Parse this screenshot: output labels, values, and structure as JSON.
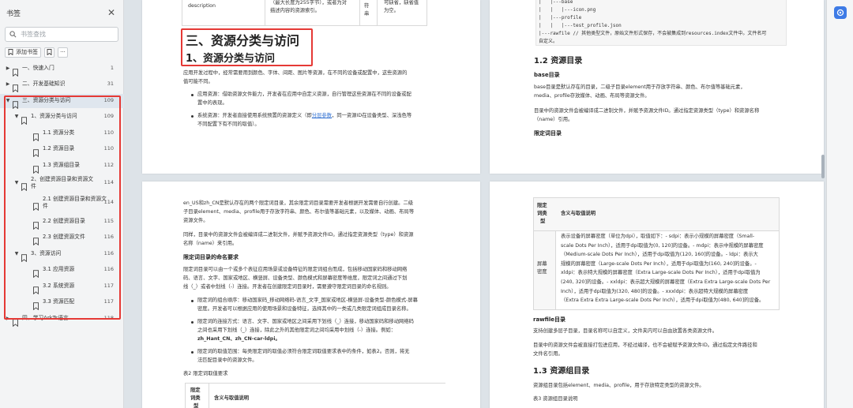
{
  "sidebar": {
    "title": "书签",
    "search_placeholder": "书签查找",
    "add_bookmark": "添加书签",
    "more": "···",
    "items": [
      {
        "label": "一、快速入门",
        "page": "1",
        "caret": "right",
        "level": 0
      },
      {
        "label": "二、开发基础知识",
        "page": "31",
        "caret": "right",
        "level": 0
      },
      {
        "label": "三、资源分类与访问",
        "page": "109",
        "caret": "down",
        "level": 0,
        "active": true
      },
      {
        "label": "1、资源分类与访问",
        "page": "109",
        "caret": "down",
        "level": 1
      },
      {
        "label": "1.1 资源分类",
        "page": "110",
        "caret": "",
        "level": 2
      },
      {
        "label": "1.2 资源目录",
        "page": "110",
        "caret": "",
        "level": 2
      },
      {
        "label": "1.3 资源组目录",
        "page": "112",
        "caret": "",
        "level": 2
      },
      {
        "label": "2、创建资源目录和资源文",
        "label2": "件",
        "page": "114",
        "caret": "down",
        "level": 1
      },
      {
        "label": "2.1 创建资源目录和资源文",
        "label2": "件",
        "page": "114",
        "caret": "",
        "level": 2
      },
      {
        "label": "2.2 创建资源目录",
        "page": "115",
        "caret": "",
        "level": 2
      },
      {
        "label": "2.3 创建资源文件",
        "page": "116",
        "caret": "",
        "level": 2
      },
      {
        "label": "3、资源访问",
        "page": "116",
        "caret": "down",
        "level": 1
      },
      {
        "label": "3.1 应用资源",
        "page": "116",
        "caret": "",
        "level": 2
      },
      {
        "label": "3.2 系统资源",
        "page": "117",
        "caret": "",
        "level": 2
      },
      {
        "label": "3.3 资源匹配",
        "page": "117",
        "caret": "",
        "level": 2
      },
      {
        "label": "四、学习ArkTs语言",
        "page": "118",
        "caret": "right",
        "level": 0
      }
    ]
  },
  "page1": {
    "table_c1": "description",
    "table_c2a": "（最大长度为255字节），或者为对",
    "table_c2b": "描述内容的资源索引。",
    "table_c3a": "符",
    "table_c3b": "串",
    "table_c4": "可缺省，缺省值为空。",
    "chapter": "三、资源分类与访问",
    "section": "1、资源分类与访问",
    "p1a": "应用开发过程中，经常需要用到颜色、字体、间距、图片等资源，在不同的设备或配置中，这些资源的",
    "p1b": "值可能不同。",
    "b1a": "应用资源：借助资源文件能力，开发者在应用中自定义资源，自行管理这些资源在不同的设备或配",
    "b1b": "置中的表现。",
    "b2a_pre": "系统资源：开发者直接使用系统预置的资源定义（即",
    "b2a_link": "分层参数",
    "b2a_post": "，同一资源ID在设备类型、深浅色等",
    "b2b": "不同配置下有不同的取值）。"
  },
  "page2": {
    "code": [
      "|   |---base",
      "|   |   |---icon.png",
      "|   |---profile",
      "|   |   |---test_profile.json",
      "|---rawfile // 其他类型文件，原始文件形式保存，不会被集成到resources.index文件中。文件名可",
      "自定义。"
    ],
    "h_12": "1.2 资源目录",
    "h_base": "base目录",
    "p1a": "base目录是默认存在的目录，二级子目录element用于存放字符串、颜色、布尔值等基础元素，",
    "p1b": "media、profile存放媒体、动画、布局等资源文件。",
    "p2a": "目录中的资源文件会被编译成二进制文件，并赋予资源文件ID。通过指定资源类型（type）和资源名称",
    "p2b": "（name）引用。",
    "h_qual": "限定词目录"
  },
  "page3": {
    "p1a": "en_US和zh_CN是默认存在的两个限定词目录，其余限定词目录需要开发者根据开发需要自行创建。二级",
    "p1b": "子目录element、media、profile用于存放字符串、颜色、布尔值等基础元素，以及媒体、动画、布局等",
    "p1c": "资源文件。",
    "p2a": "同样，目录中的资源文件会被编译成二进制文件，并赋予资源文件ID。通过指定资源类型（type）和资源",
    "p2b": "名称（name）来引用。",
    "h_rule": "限定词目录的命名要求",
    "p3a": "限定词目录可以由一个或多个表征应用场景或设备特征的限定词组合而成，包括移动国家码和移动网络",
    "p3b": "码、语言、文字、国家或地区、横竖屏、设备类型、颜色模式和屏幕密度等维度，限定词之间通过下划",
    "p3c": "线（_）或者中划线（-）连接。开发者在创建限定词目录时，需要遵守限定词目录的命名规则。",
    "b1a": "限定词的组合顺序：移动国家码_移动网络码-语言_文字_国家或地区-横竖屏-设备类型-颜色模式-屏幕",
    "b1b": "密度。开发者可以根据应用的使用场景和设备特征，选择其中的一类或几类限定词组成目录名称。",
    "b2a": "限定词的连接方式：语言、文字、国家或地区之间采用下划线（_）连接，移动国家码和移动网络码",
    "b2b": "之间也采用下划线（_）连接，除此之外的其他限定词之间均采用中划线（-）连接。例如：",
    "b2c": "zh_Hant_CN、zh_CN-car-ldpi。",
    "b3a": "限定词的取值范围：每类限定词的取值必须符合限定词取值要求表中的条件，如表2。否则，将无",
    "b3b": "法匹配目录中的资源文件。",
    "caption": "表2 限定词取值要求",
    "th1a": "限定",
    "th1b": "词类",
    "th1c": "型",
    "th2": "含义与取值说明"
  },
  "page4": {
    "th1a": "限定",
    "th1b": "词类",
    "th1c": "型",
    "th2": "含义与取值说明",
    "td1a": "屏幕",
    "td1b": "密度",
    "lines": [
      "表示设备的屏幕密度（单位为dpi），取值如下：- sdpi：表示小规模的屏幕密度（Small-",
      "scale Dots Per Inch），适用于dpi取值为(0, 120]的设备。- mdpi：表示中规模的屏幕密度",
      "（Medium-scale Dots Per Inch），适用于dpi取值为(120, 160]的设备。- ldpi：表示大",
      "规模的屏幕密度（Large-scale Dots Per Inch），适用于dpi取值为(160, 240]的设备。-",
      "xldpi：表示特大规模的屏幕密度（Extra Large-scale Dots Per Inch），适用于dpi取值为",
      "(240, 320]的设备。- xxldpi：表示超大规模的屏幕密度（Extra Extra Large-scale Dots Per",
      "Inch），适用于dpi取值为(320, 480]的设备。- xxxldpi：表示超特大规模的屏幕密度",
      "（Extra Extra Extra Large-scale Dots Per Inch），适用于dpi取值为(480, 640]的设备。"
    ],
    "h_raw": "rawfile目录",
    "p1": "支持创建多层子目录，目录名称可以自定义，文件夹内可以自由放置各类资源文件。",
    "p2a": "目录中的资源文件会被直接打包进应用，不经过编译，也不会被赋予资源文件ID。通过指定文件路径和",
    "p2b": "文件名引用。",
    "h_13": "1.3 资源组目录",
    "p3": "资源组目录包括element、media、profile，用于存放特定类型的资源文件。",
    "caption": "表3 资源组目录说明"
  }
}
